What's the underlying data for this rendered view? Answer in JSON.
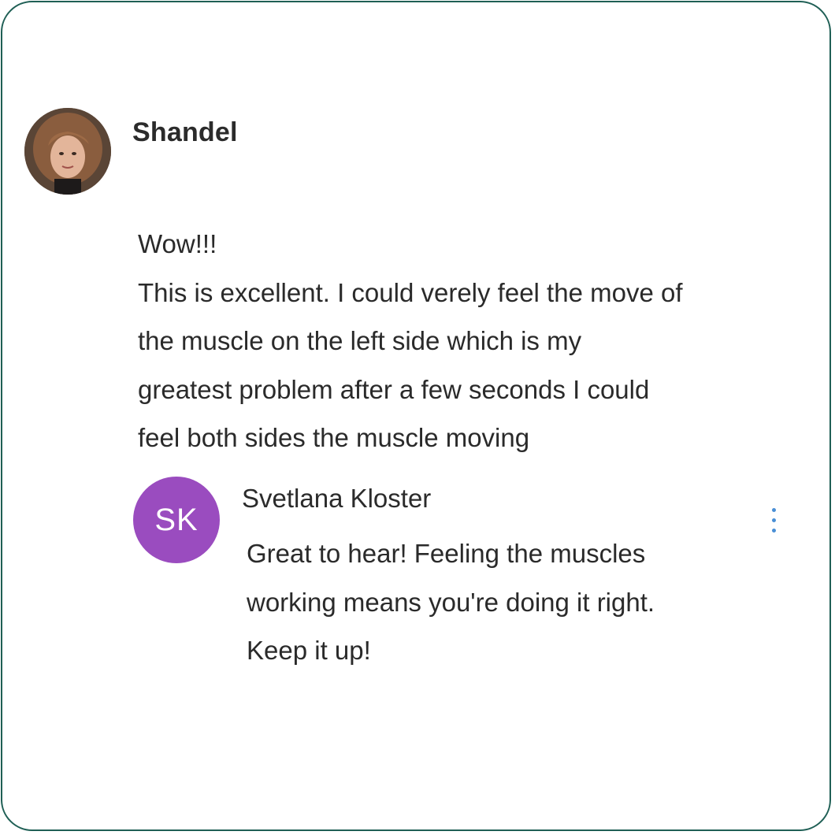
{
  "comment": {
    "author": "Shandel",
    "avatar_icon": "user-photo",
    "lines": [
      "Wow!!!",
      "This is excellent. I could verely feel the move of",
      "the muscle on the left side which is my",
      "greatest problem after a few seconds I could",
      "feel both sides the muscle moving"
    ]
  },
  "reply": {
    "initials": "SK",
    "avatar_color": "#9a4cbf",
    "author": "Svetlana Kloster",
    "menu_icon": "more-vertical-icon",
    "menu_color": "#4a8fd6",
    "lines": [
      "Great to hear! Feeling the muscles",
      "working means you're doing it right.",
      "Keep it up!"
    ]
  },
  "frame": {
    "border_color": "#1f5f55"
  }
}
